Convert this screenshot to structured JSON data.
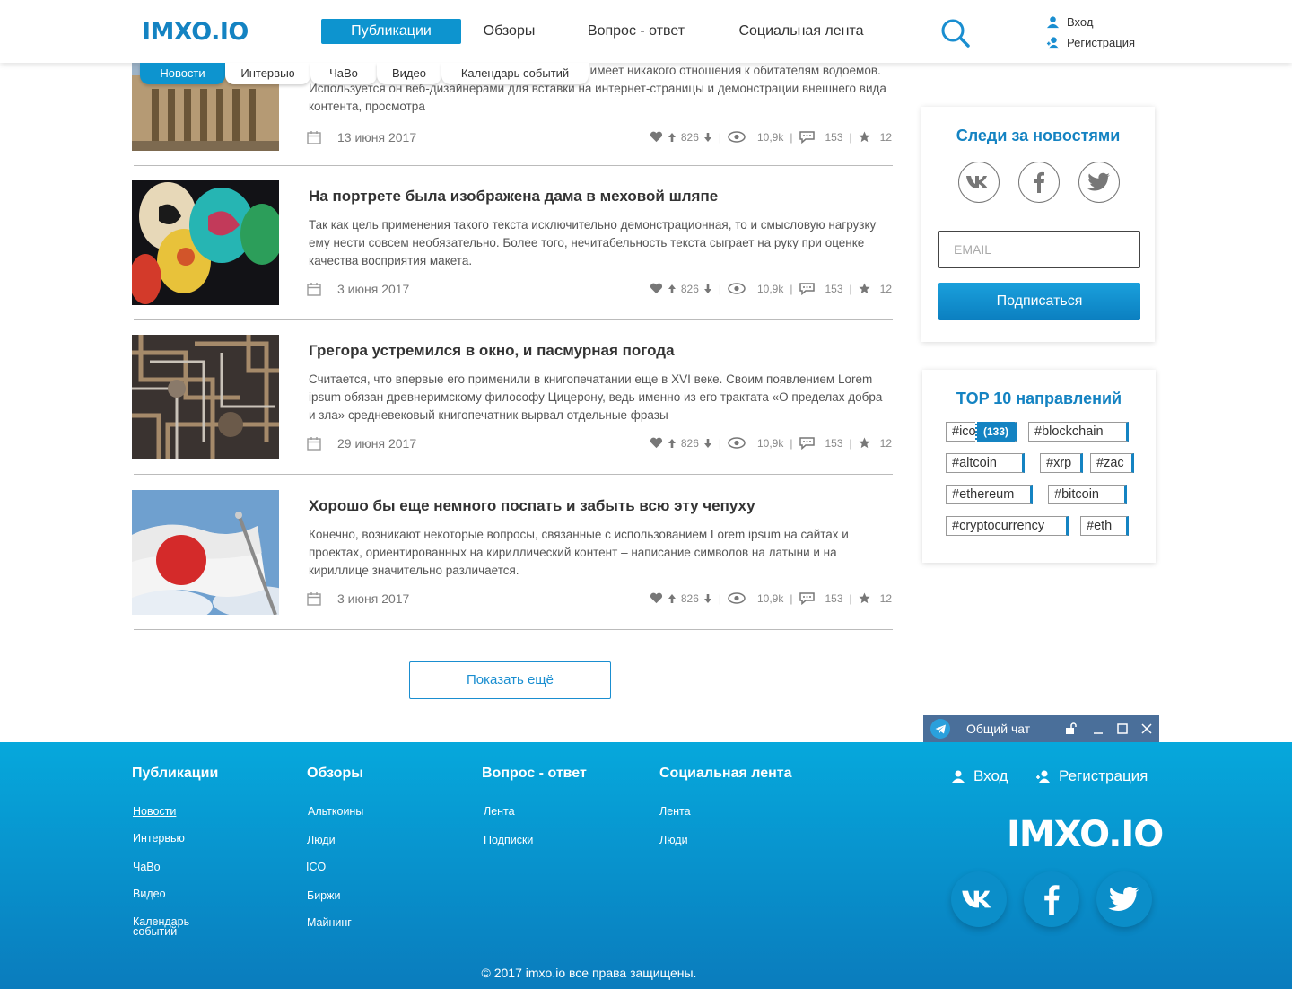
{
  "header": {
    "logo": "IMXO.IO",
    "nav": [
      "Публикации",
      "Обзоры",
      "Вопрос - ответ",
      "Социальная лента"
    ],
    "login": "Вход",
    "register": "Регистрация"
  },
  "subnav": [
    "Новости",
    "Интервью",
    "ЧаВо",
    "Видео",
    "Календарь событий"
  ],
  "articles": [
    {
      "title": "",
      "excerpt": "кст-«рыба». Текст этот, несмотря на название, не имеет никакого отношения к обитателям водоемов. Используется он веб-дизайнерами для вставки на интернет-страницы и демонстрации внешнего вида контента, просмотра",
      "date": "13 июня 2017",
      "likes": "826",
      "views": "10,9k",
      "comments": "153",
      "stars": "12"
    },
    {
      "title": "На портрете была изображена дама в меховой шляпе",
      "excerpt": "Так как цель применения такого текста исключительно демонстрационная, то и смысловую нагрузку ему нести совсем необязательно. Более того, нечитабельность текста сыграет на руку при оценке качества восприятия макета.",
      "date": "3 июня 2017",
      "likes": "826",
      "views": "10,9k",
      "comments": "153",
      "stars": "12"
    },
    {
      "title": "Грегора устремился в окно, и пасмурная погода",
      "excerpt": "Считается, что впервые его применили в книгопечатании еще в XVI веке. Своим появлением Lorem ipsum обязан древнеримскому философу Цицерону, ведь именно из его трактата «О пределах добра и зла» средневековый книгопечатник вырвал отдельные фразы",
      "date": "29 июня 2017",
      "likes": "826",
      "views": "10,9k",
      "comments": "153",
      "stars": "12"
    },
    {
      "title": "Хорошо бы еще немного поспать и забыть всю эту чепуху",
      "excerpt": "Конечно, возникают некоторые вопросы, связанные с использованием Lorem ipsum на сайтах и проектах, ориентированных на кириллический контент – написание символов на латыни и на кириллице значительно различается.",
      "date": "3 июня 2017",
      "likes": "826",
      "views": "10,9k",
      "comments": "153",
      "stars": "12"
    }
  ],
  "show_more": "Показать ещё",
  "subscribe": {
    "title": "Следи за новостями",
    "email_placeholder": "EMAIL",
    "button": "Подписаться"
  },
  "top10": {
    "title": "TOP 10 направлений",
    "tags": [
      "#ico",
      "#blockchain",
      "#altcoin",
      "#xrp",
      "#zac",
      "#ethereum",
      "#bitcoin",
      "#cryptocurrency",
      "#eth"
    ],
    "ico_count": "(133)"
  },
  "chat": {
    "label": "Общий чат"
  },
  "footer": {
    "columns": [
      {
        "title": "Публикации",
        "links": [
          "Новости",
          "Интервью",
          "ЧаВо",
          "Видео",
          "Календарь событий"
        ]
      },
      {
        "title": "Обзоры",
        "links": [
          "Альткоины",
          "Люди",
          "ICO",
          "Биржи",
          "Майнинг"
        ]
      },
      {
        "title": "Вопрос - ответ",
        "links": [
          "Лента",
          "Подписки"
        ]
      },
      {
        "title": "Социальная лента",
        "links": [
          "Лента",
          "Люди"
        ]
      }
    ],
    "login": "Вход",
    "register": "Регистрация",
    "logo": "IMXO.IO",
    "copyright": "© 2017 imxo.io все права защищены."
  },
  "colors": {
    "accent": "#0d94cf",
    "brand": "#1483c2",
    "footer_top": "#06a8dc",
    "footer_bottom": "#0a7cbd",
    "chat_bar": "#4a6f9a"
  },
  "icons": [
    "search-icon",
    "user-icon",
    "user-plus-icon",
    "calendar-icon",
    "heart-icon",
    "arrow-up-icon",
    "arrow-down-icon",
    "eye-icon",
    "comment-icon",
    "star-icon",
    "vk-icon",
    "facebook-icon",
    "twitter-icon",
    "telegram-icon",
    "lock-icon",
    "minimize-icon",
    "maximize-icon",
    "close-icon"
  ]
}
